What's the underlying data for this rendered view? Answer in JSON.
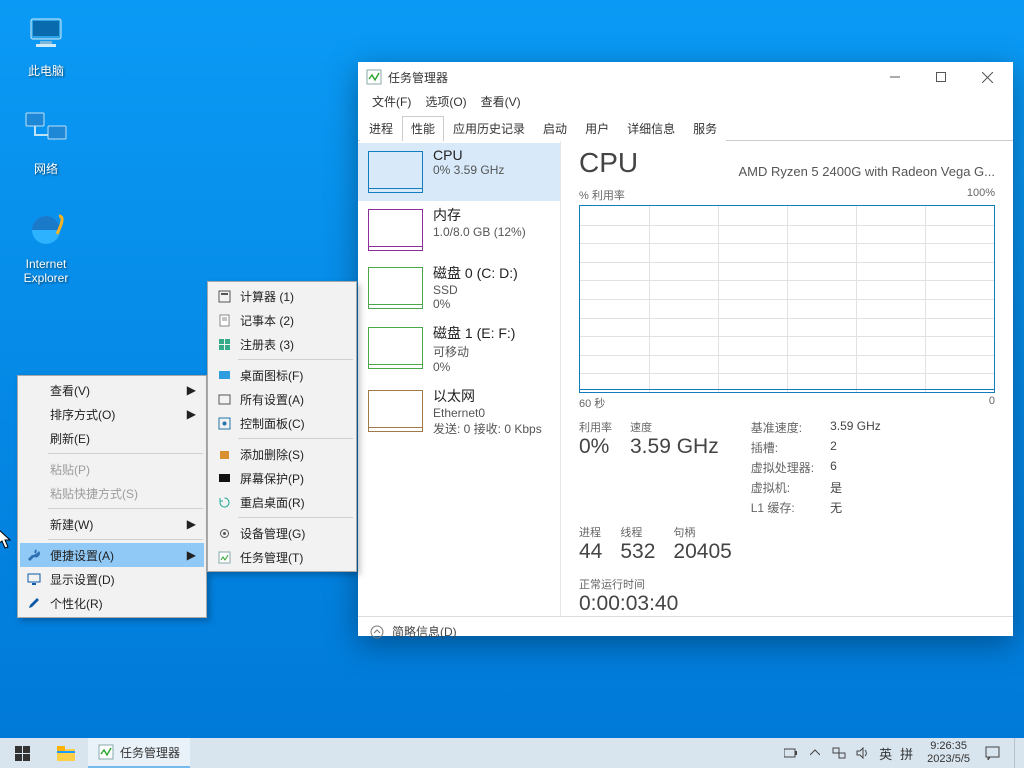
{
  "desktop": {
    "icons": [
      {
        "label": "此电脑"
      },
      {
        "label": "网络"
      },
      {
        "label": "Internet Explorer"
      }
    ]
  },
  "task_manager": {
    "title": "任务管理器",
    "menu": {
      "file": "文件(F)",
      "options": "选项(O)",
      "view": "查看(V)"
    },
    "tabs": {
      "proc": "进程",
      "perf": "性能",
      "hist": "应用历史记录",
      "startup": "启动",
      "users": "用户",
      "details": "详细信息",
      "services": "服务"
    },
    "left": {
      "cpu": {
        "title": "CPU",
        "sub": "0% 3.59 GHz"
      },
      "mem": {
        "title": "内存",
        "sub": "1.0/8.0 GB (12%)"
      },
      "disk0": {
        "title": "磁盘 0 (C: D:)",
        "sub1": "SSD",
        "sub2": "0%"
      },
      "disk1": {
        "title": "磁盘 1 (E: F:)",
        "sub1": "可移动",
        "sub2": "0%"
      },
      "eth": {
        "title": "以太网",
        "sub1": "Ethernet0",
        "sub2": "发送: 0 接收: 0 Kbps"
      }
    },
    "right": {
      "heading": "CPU",
      "cpu_name": "AMD Ryzen 5 2400G with Radeon Vega G...",
      "util_label": "% 利用率",
      "max_label": "100%",
      "xleft": "60 秒",
      "xright": "0",
      "stats": {
        "util_l": "利用率",
        "util_v": "0%",
        "speed_l": "速度",
        "speed_v": "3.59 GHz",
        "proc_l": "进程",
        "proc_v": "44",
        "thr_l": "线程",
        "thr_v": "532",
        "hnd_l": "句柄",
        "hnd_v": "20405"
      },
      "kv": {
        "base_l": "基准速度:",
        "base_v": "3.59 GHz",
        "sock_l": "插槽:",
        "sock_v": "2",
        "vcpu_l": "虚拟处理器:",
        "vcpu_v": "6",
        "vm_l": "虚拟机:",
        "vm_v": "是",
        "l1_l": "L1 缓存:",
        "l1_v": "无"
      },
      "uptime_l": "正常运行时间",
      "uptime_v": "0:00:03:40"
    },
    "footer": "简略信息(D)"
  },
  "ctx1": {
    "view": "查看(V)",
    "sort": "排序方式(O)",
    "refresh": "刷新(E)",
    "paste": "粘贴(P)",
    "paste_link": "粘贴快捷方式(S)",
    "new": "新建(W)",
    "quick": "便捷设置(A)",
    "disp": "显示设置(D)",
    "pers": "个性化(R)"
  },
  "ctx2": {
    "calc": "计算器  (1)",
    "notepad": "记事本  (2)",
    "regedit": "注册表  (3)",
    "deskicons": "桌面图标(F)",
    "settings": "所有设置(A)",
    "ctrlpanel": "控制面板(C)",
    "addremove": "添加删除(S)",
    "screensaver": "屏幕保护(P)",
    "restartdesk": "重启桌面(R)",
    "devmgr": "设备管理(G)",
    "taskmgr": "任务管理(T)"
  },
  "taskbar": {
    "app": "任务管理器",
    "ime1": "英",
    "ime2": "拼",
    "time": "9:26:35",
    "date": "2023/5/5"
  },
  "chart_data": {
    "type": "line",
    "title": "CPU % 利用率",
    "xlabel": "秒",
    "ylabel": "% 利用率",
    "xlim": [
      0,
      60
    ],
    "ylim": [
      0,
      100
    ],
    "x": [
      60,
      50,
      40,
      30,
      20,
      10,
      0
    ],
    "series": [
      {
        "name": "CPU",
        "values": [
          0,
          0,
          0,
          0,
          0,
          0,
          0
        ]
      }
    ]
  }
}
